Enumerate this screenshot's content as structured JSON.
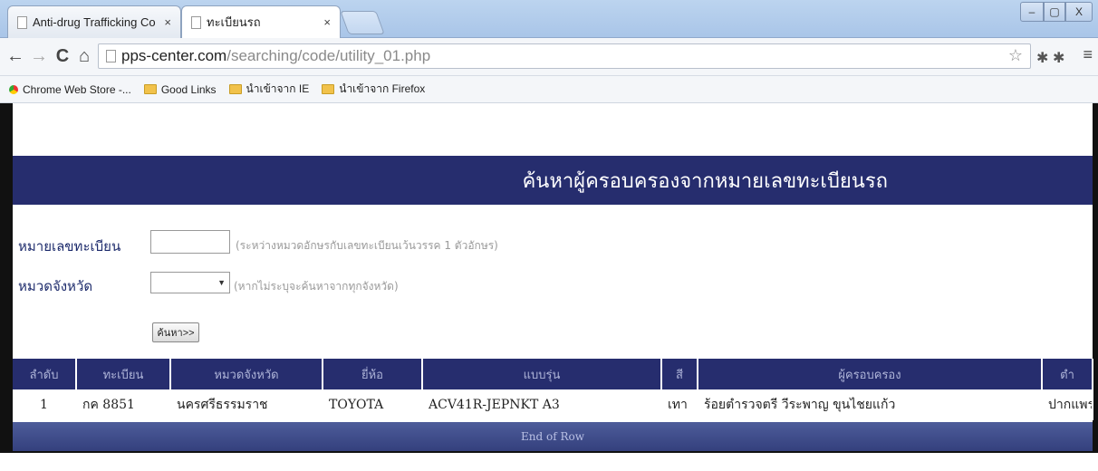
{
  "browser": {
    "tabs": [
      {
        "label": "Anti-drug Trafficking Co",
        "close": "×"
      },
      {
        "label": "ทะเบียนรถ",
        "close": "×"
      }
    ],
    "window_controls": {
      "minimize": "–",
      "maximize": "▢",
      "close": "X"
    },
    "url_host": "pps-center.com",
    "url_path": "/searching/code/utility_01.php",
    "bookmarks": [
      {
        "label": "Chrome Web Store -...",
        "icon": "store-icon"
      },
      {
        "label": "Good Links",
        "icon": "folder-icon"
      },
      {
        "label": "นำเข้าจาก IE",
        "icon": "folder-icon"
      },
      {
        "label": "นำเข้าจาก Firefox",
        "icon": "folder-icon"
      }
    ]
  },
  "page": {
    "banner_title": "ค้นหาผู้ครอบครองจากหมายเลขทะเบียนรถ",
    "form": {
      "plate_label": "หมายเลขทะเบียน",
      "plate_value": "",
      "plate_hint": "(ระหว่างหมวดอักษรกับเลขทะเบียนเว้นวรรค 1 ตัวอักษร)",
      "province_label": "หมวดจังหวัด",
      "province_value": "",
      "province_hint": "(หากไม่ระบุจะค้นหาจากทุกจังหวัด)",
      "search_button": "ค้นหา>>"
    },
    "table": {
      "headers": [
        "ลำดับ",
        "ทะเบียน",
        "หมวดจังหวัด",
        "ยี่ห้อ",
        "แบบรุ่น",
        "สี",
        "ผู้ครอบครอง",
        "ตำ"
      ],
      "rows": [
        [
          "1",
          "กค 8851",
          "นครศรีธรรมราช",
          "TOYOTA",
          "ACV41R-JEPNKT A3",
          "เทา",
          "ร้อยตำรวจตรี วีระพาญ ขุนไชยแก้ว",
          "ปากแพร"
        ]
      ],
      "end_text": "End of Row"
    }
  },
  "colors": {
    "banner_bg": "#262d6e",
    "label_color": "#1c2a6b"
  }
}
